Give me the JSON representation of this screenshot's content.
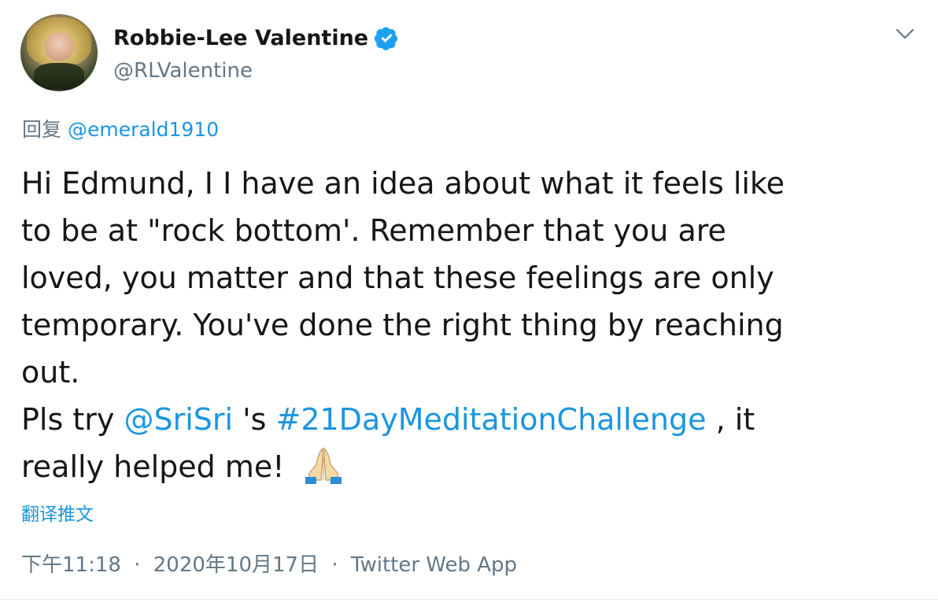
{
  "tweet": {
    "author": {
      "display_name": "Robbie-Lee Valentine",
      "handle": "@RLValentine",
      "verified": true,
      "avatar_icon": "avatar-photo"
    },
    "menu_icon": "chevron-down-icon",
    "reply_label": "回复",
    "reply_mention": "@emerald1910",
    "body": {
      "line1": "Hi Edmund, I I have an idea about what it feels like",
      "line2": "to be at \"rock bottom'. Remember that you are",
      "line3": "loved, you matter and that these feelings are only",
      "line4": "temporary. You've done the right thing by reaching",
      "line5": "out.",
      "line6_prefix": "Pls try ",
      "line6_mention": "@SriSri",
      "line6_possessive": "'s ",
      "line6_hashtag": "#21DayMeditationChallenge",
      "line6_suffix": ", it",
      "line7": "really helped me!",
      "emoji": "folded-hands-emoji"
    },
    "translate_label": "翻译推文",
    "timestamp": "下午11:18",
    "date": "2020年10月17日",
    "source": "Twitter Web App",
    "separator": "·",
    "colors": {
      "link": "#1b95e0",
      "secondary_text": "#657786",
      "primary_text": "#14171a",
      "verified": "#1da1f2"
    }
  }
}
